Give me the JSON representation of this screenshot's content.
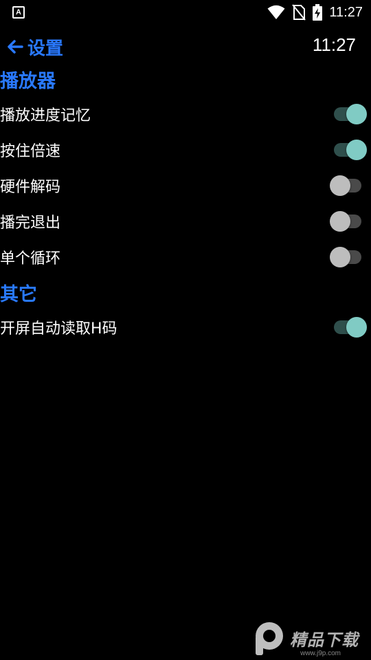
{
  "status_bar": {
    "app_icon_letter": "A",
    "time": "11:27",
    "icons": [
      "wifi-icon",
      "no-sim-icon",
      "battery-charging-icon"
    ]
  },
  "header": {
    "title": "设置",
    "clock": "11:27"
  },
  "sections": {
    "player": {
      "title": "播放器",
      "items": [
        {
          "label": "播放进度记忆",
          "enabled": true
        },
        {
          "label": "按住倍速",
          "enabled": true
        },
        {
          "label": "硬件解码",
          "enabled": false
        },
        {
          "label": "播完退出",
          "enabled": false
        },
        {
          "label": "单个循环",
          "enabled": false
        }
      ]
    },
    "other": {
      "title": "其它",
      "items": [
        {
          "label": "开屏自动读取H码",
          "enabled": true
        }
      ]
    }
  },
  "colors": {
    "accent": "#2979ff",
    "switch_on_thumb": "#80cbc4",
    "switch_on_track": "#2f4f4c",
    "switch_off_thumb": "#bdbdbd",
    "switch_off_track": "#4a4a4a",
    "background": "#000000"
  },
  "watermark": {
    "text": "精品下载",
    "sub": "www.j9p.com"
  }
}
